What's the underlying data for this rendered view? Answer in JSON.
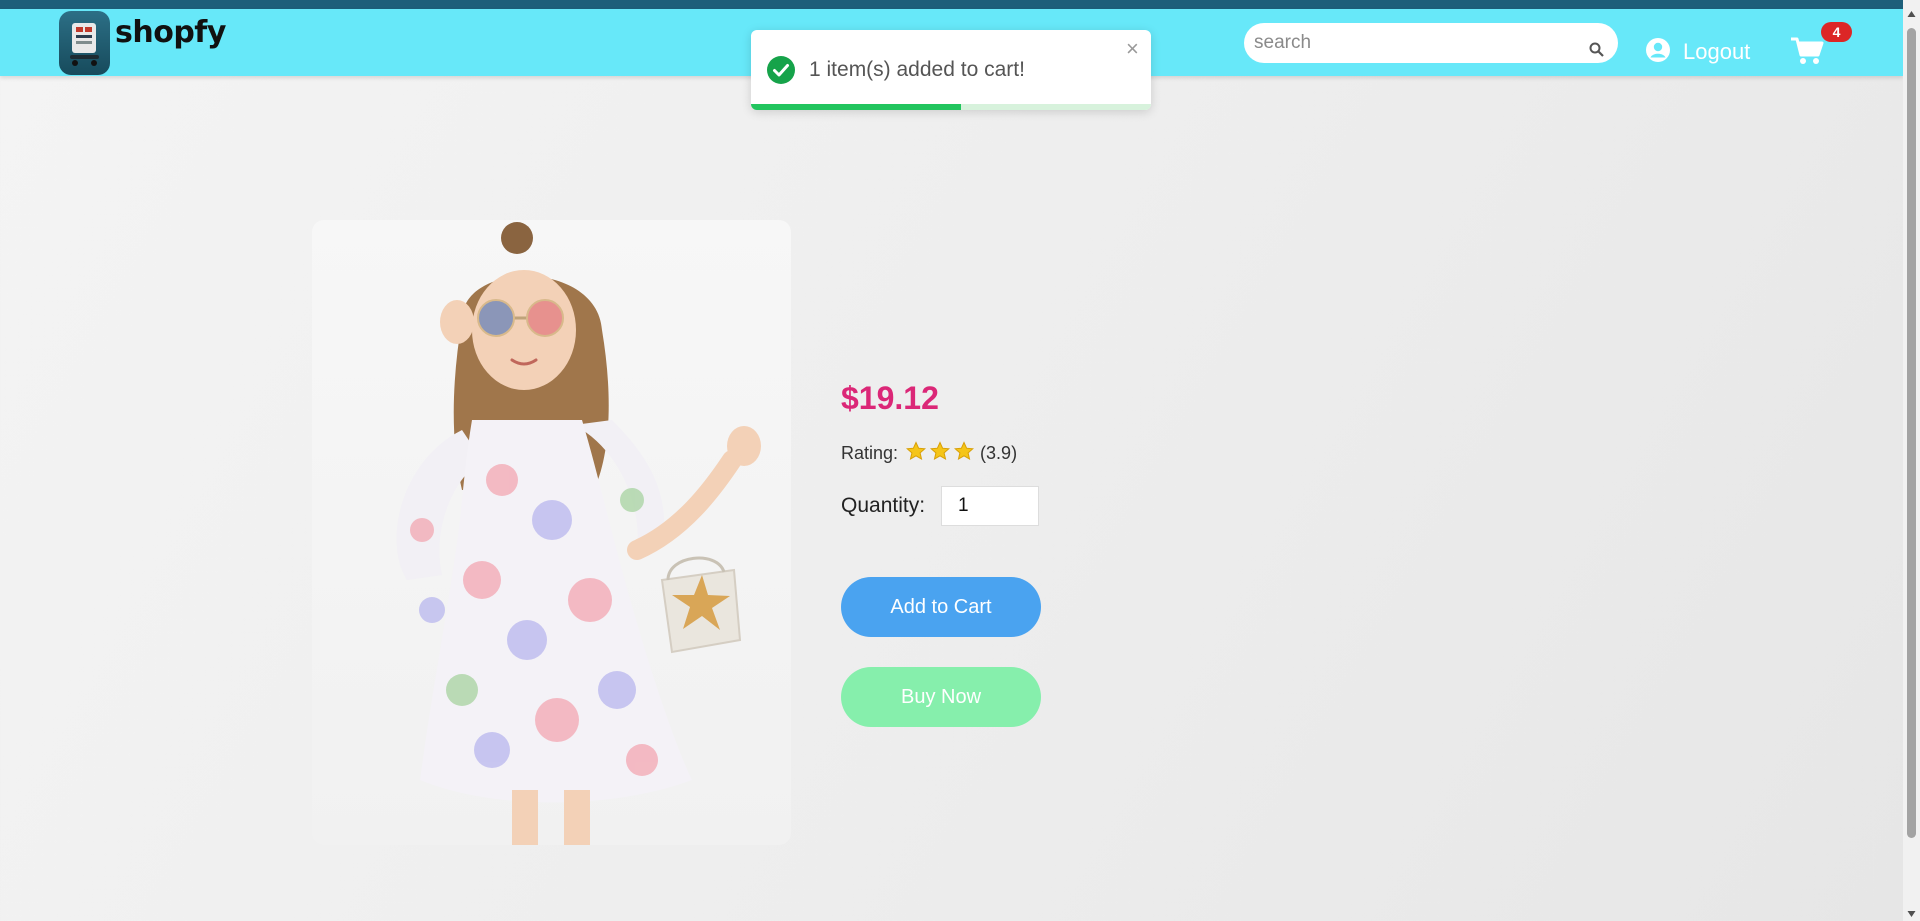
{
  "header": {
    "brand": "shopfy",
    "logo_icon": "shop-logo-icon",
    "search": {
      "placeholder": "search",
      "value": "",
      "icon": "search-icon"
    },
    "logout_label": "Logout",
    "user_icon": "user-circle-icon",
    "cart_icon": "cart-icon",
    "cart_count": "4"
  },
  "toast": {
    "message": "1 item(s) added to cart!",
    "close_label": "×",
    "icon": "check-circle-icon",
    "progress": 0.525
  },
  "product": {
    "price": "$19.12",
    "rating_label": "Rating:",
    "rating_stars": 3,
    "rating_value": "(3.9)",
    "quantity_label": "Quantity:",
    "quantity_value": "1",
    "add_to_cart_label": "Add to Cart",
    "buy_now_label": "Buy Now"
  },
  "colors": {
    "navbar": "#67e8f9",
    "price": "#db2777",
    "add_to_cart": "#4aa3f0",
    "buy_now": "#86efac",
    "badge": "#dc2626",
    "toast_progress": "#22c55e"
  }
}
